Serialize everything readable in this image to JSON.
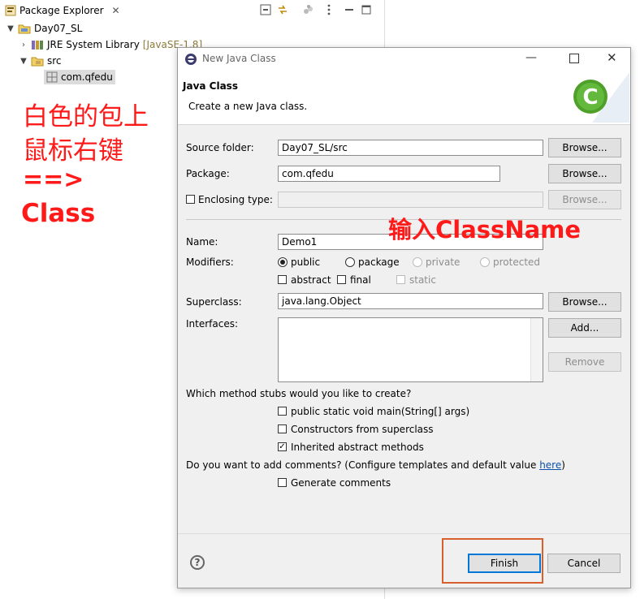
{
  "explorer": {
    "tab_label": "Package Explorer",
    "tree": {
      "project": "Day07_SL",
      "jre_label": "JRE System Library",
      "jre_version": "[JavaSE-1.8]",
      "src": "src",
      "package": "com.qfedu"
    }
  },
  "annotations": {
    "left_line1": "白色的包上",
    "left_line2": "鼠标右键",
    "left_arrow": "==>",
    "left_class": "Class",
    "classname_hint": "输入ClassName"
  },
  "dialog": {
    "title": "New Java Class",
    "heading": "Java Class",
    "subheading": "Create a new Java class.",
    "source_folder_label": "Source folder:",
    "source_folder_value": "Day07_SL/src",
    "package_label": "Package:",
    "package_value": "com.qfedu",
    "enclosing_label": "Enclosing type:",
    "enclosing_value": "",
    "name_label": "Name:",
    "name_value": "Demo1",
    "modifiers_label": "Modifiers:",
    "modifiers": {
      "public": "public",
      "package": "package",
      "private": "private",
      "protected": "protected",
      "abstract": "abstract",
      "final": "final",
      "static": "static"
    },
    "superclass_label": "Superclass:",
    "superclass_value": "java.lang.Object",
    "interfaces_label": "Interfaces:",
    "browse": "Browse...",
    "add": "Add...",
    "remove": "Remove",
    "stubs_question": "Which method stubs would you like to create?",
    "stub_main": "public static void main(String[] args)",
    "stub_constructors": "Constructors from superclass",
    "stub_inherited": "Inherited abstract methods",
    "comments_question": "Do you want to add comments? (Configure templates and default value ",
    "comments_link": "here",
    "comments_tail": ")",
    "generate_comments": "Generate comments",
    "finish": "Finish",
    "cancel": "Cancel",
    "help_glyph": "?"
  },
  "colors": {
    "annotation": "#ff1a1a",
    "highlight_box": "#d9602c",
    "link": "#0b4fa8"
  }
}
